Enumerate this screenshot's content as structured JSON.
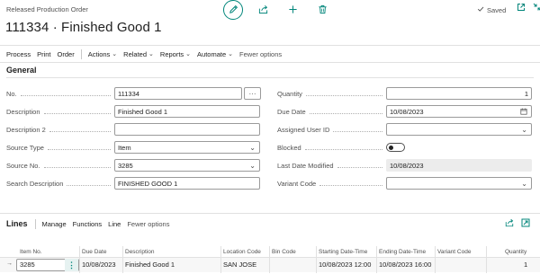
{
  "header": {
    "breadcrumb": "Released Production Order",
    "title": "111334 · Finished Good 1",
    "saved": "Saved"
  },
  "actions": {
    "process": "Process",
    "print": "Print",
    "order": "Order",
    "actions": "Actions",
    "related": "Related",
    "reports": "Reports",
    "automate": "Automate",
    "fewer": "Fewer options"
  },
  "general": {
    "title": "General",
    "no_label": "No.",
    "no_value": "111334",
    "description_label": "Description",
    "description_value": "Finished Good 1",
    "description2_label": "Description 2",
    "description2_value": "",
    "source_type_label": "Source Type",
    "source_type_value": "Item",
    "source_no_label": "Source No.",
    "source_no_value": "3285",
    "search_desc_label": "Search Description",
    "search_desc_value": "FINISHED GOOD 1",
    "quantity_label": "Quantity",
    "quantity_value": "1",
    "due_date_label": "Due Date",
    "due_date_value": "10/08/2023",
    "assigned_user_label": "Assigned User ID",
    "assigned_user_value": "",
    "blocked_label": "Blocked",
    "blocked_value": false,
    "last_modified_label": "Last Date Modified",
    "last_modified_value": "10/08/2023",
    "variant_code_label": "Variant Code",
    "variant_code_value": ""
  },
  "lines": {
    "title": "Lines",
    "manage": "Manage",
    "functions": "Functions",
    "line": "Line",
    "fewer": "Fewer options",
    "columns": {
      "item_no": "Item No.",
      "due_date": "Due Date",
      "description": "Description",
      "location_code": "Location Code",
      "bin_code": "Bin Code",
      "starting": "Starting Date-Time",
      "ending": "Ending Date-Time",
      "variant_code": "Variant Code",
      "quantity": "Quantity"
    },
    "row": {
      "item_no": "3285",
      "due_date": "10/08/2023",
      "description": "Finished Good 1",
      "location_code": "SAN JOSE",
      "bin_code": "",
      "starting": "10/08/2023 12:00",
      "ending": "10/08/2023 16:00",
      "variant_code": "",
      "quantity": "1"
    }
  },
  "icons": {
    "edit": "pencil-icon",
    "share": "share-icon",
    "new": "plus-icon",
    "delete": "trash-icon",
    "saved": "checkmark-icon",
    "open_new_window": "open-in-new-window-icon",
    "collapse": "collapse-icon",
    "calendar": "calendar-icon",
    "lines_share": "share-icon",
    "lines_expand": "expand-icon",
    "row_arrow": "row-arrow-icon",
    "row_menu": "vertical-ellipsis-icon"
  },
  "colors": {
    "accent": "#00857a",
    "text": "#212121",
    "muted": "#505050"
  }
}
